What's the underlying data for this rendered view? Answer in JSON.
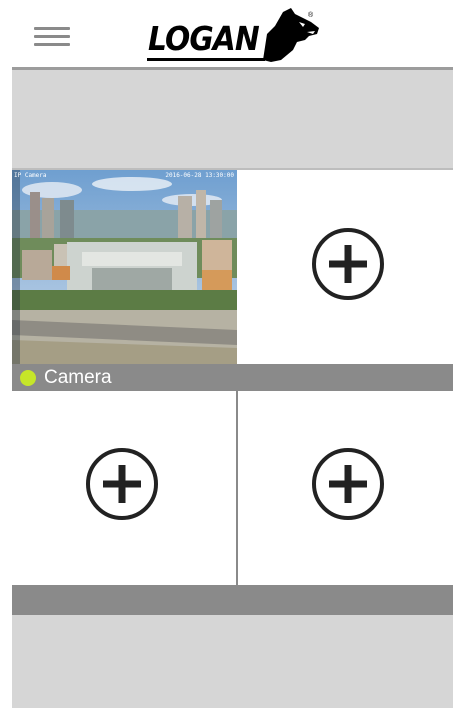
{
  "header": {
    "menu_icon": "hamburger-menu-icon",
    "logo_text": "LOGAN",
    "logo_mark": "wolf-head-logo",
    "registered": "®"
  },
  "grid": {
    "camera": {
      "name": "Camera",
      "status": "online",
      "status_color": "#c6e629",
      "overlay_left": "IP Camera",
      "overlay_right": "2016-06-28 13:30:00"
    },
    "empty_slot_icon": "add-circle-icon"
  },
  "colors": {
    "band": "#d6d6d6",
    "label_bar": "#8a8a8a",
    "divider": "#9c9c9c"
  }
}
